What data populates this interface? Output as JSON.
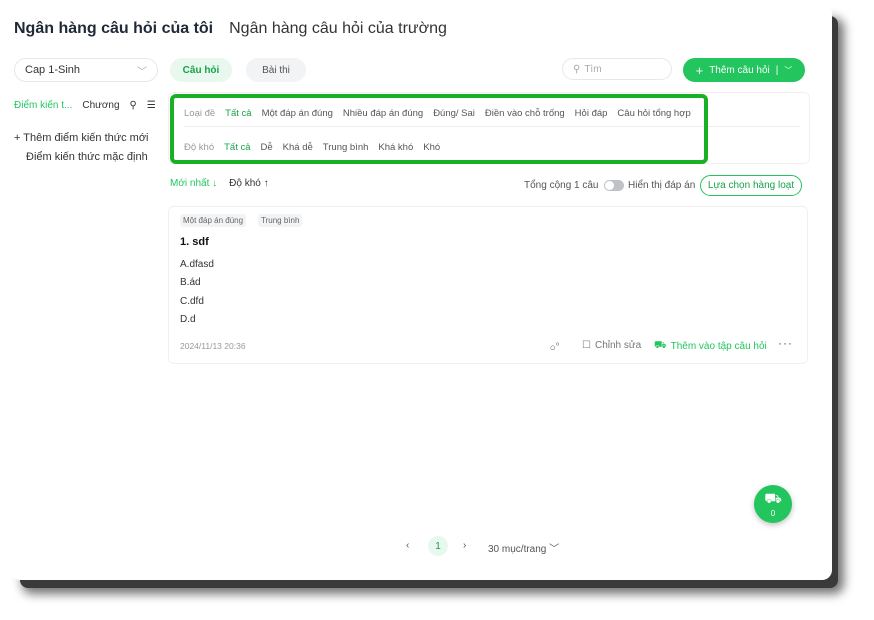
{
  "header": {
    "tab_active": "Ngân hàng câu hỏi của tôi",
    "tab_inactive": "Ngân hàng câu hỏi của trường"
  },
  "left": {
    "select_value": "Cap 1-Sinh",
    "tab_knowledge": "Điểm kiến t...",
    "tab_chapter": "Chương",
    "add_knowledge": "+ Thêm điểm kiến thức mới",
    "default_knowledge": "Điểm kiến thức mặc định"
  },
  "toolbar": {
    "tab_questions": "Câu hỏi",
    "tab_exams": "Bài thi",
    "search_placeholder": "Tìm",
    "add_button": "Thêm câu hỏi"
  },
  "filters": {
    "type_label": "Loại đề",
    "type_options": [
      "Tất cả",
      "Một đáp án đúng",
      "Nhiều đáp án đúng",
      "Đúng/ Sai",
      "Điền vào chỗ trống",
      "Hỏi đáp",
      "Câu hỏi tổng hợp"
    ],
    "difficulty_label": "Độ khó",
    "difficulty_options": [
      "Tất cả",
      "Dễ",
      "Khá dễ",
      "Trung bình",
      "Khá khó",
      "Khó"
    ]
  },
  "list": {
    "sort_newest": "Mới nhất ↓",
    "sort_difficulty": "Độ khó ↑",
    "total": "Tổng cộng 1 câu",
    "show_answer": "Hiển thị đáp án",
    "batch_select": "Lựa chọn hàng loạt"
  },
  "question": {
    "tag_type": "Một đáp án đúng",
    "tag_level": "Trung bình",
    "title": "1. sdf",
    "options": [
      "A.dfasd",
      "B.ád",
      "C.dfd",
      "D.d"
    ],
    "time": "2024/11/13 20:36",
    "edit": "Chỉnh sửa",
    "add_to_set": "Thêm vào tập câu hỏi",
    "more": "···"
  },
  "pagination": {
    "current": "1",
    "per_page": "30 mục/trang"
  },
  "basket": {
    "count": "0"
  },
  "colors": {
    "accent": "#22c55e",
    "highlight": "#19b026"
  }
}
